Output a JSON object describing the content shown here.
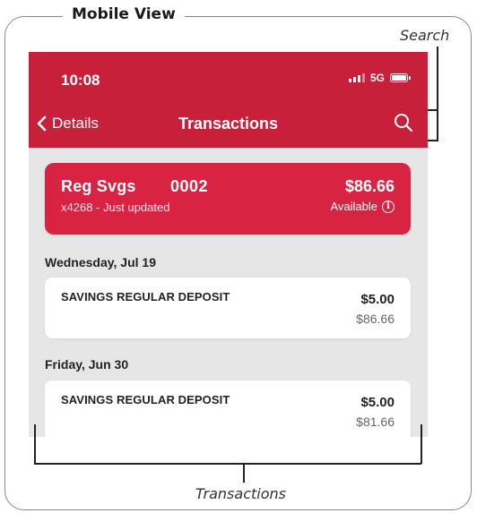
{
  "frame": {
    "title": "Mobile View"
  },
  "annotations": {
    "search": "Search",
    "transactions": "Transactions"
  },
  "status_bar": {
    "time": "10:08",
    "network": "5G"
  },
  "nav": {
    "back_label": "Details",
    "title": "Transactions",
    "search_icon": "search-icon"
  },
  "account": {
    "name": "Reg Svgs",
    "number": "0002",
    "subtitle": "x4268 - Just updated",
    "balance": "$86.66",
    "available_label": "Available",
    "info_icon": "i"
  },
  "groups": [
    {
      "date": "Wednesday, Jul 19",
      "transactions": [
        {
          "description": "SAVINGS REGULAR DEPOSIT",
          "amount": "$5.00",
          "balance": "$86.66"
        }
      ]
    },
    {
      "date": "Friday, Jun 30",
      "transactions": [
        {
          "description": "SAVINGS REGULAR DEPOSIT",
          "amount": "$5.00",
          "balance": "$81.66"
        }
      ]
    }
  ],
  "colors": {
    "brand_red": "#c8203a",
    "card_red": "#d92342",
    "list_bg": "#e6e6e6"
  }
}
